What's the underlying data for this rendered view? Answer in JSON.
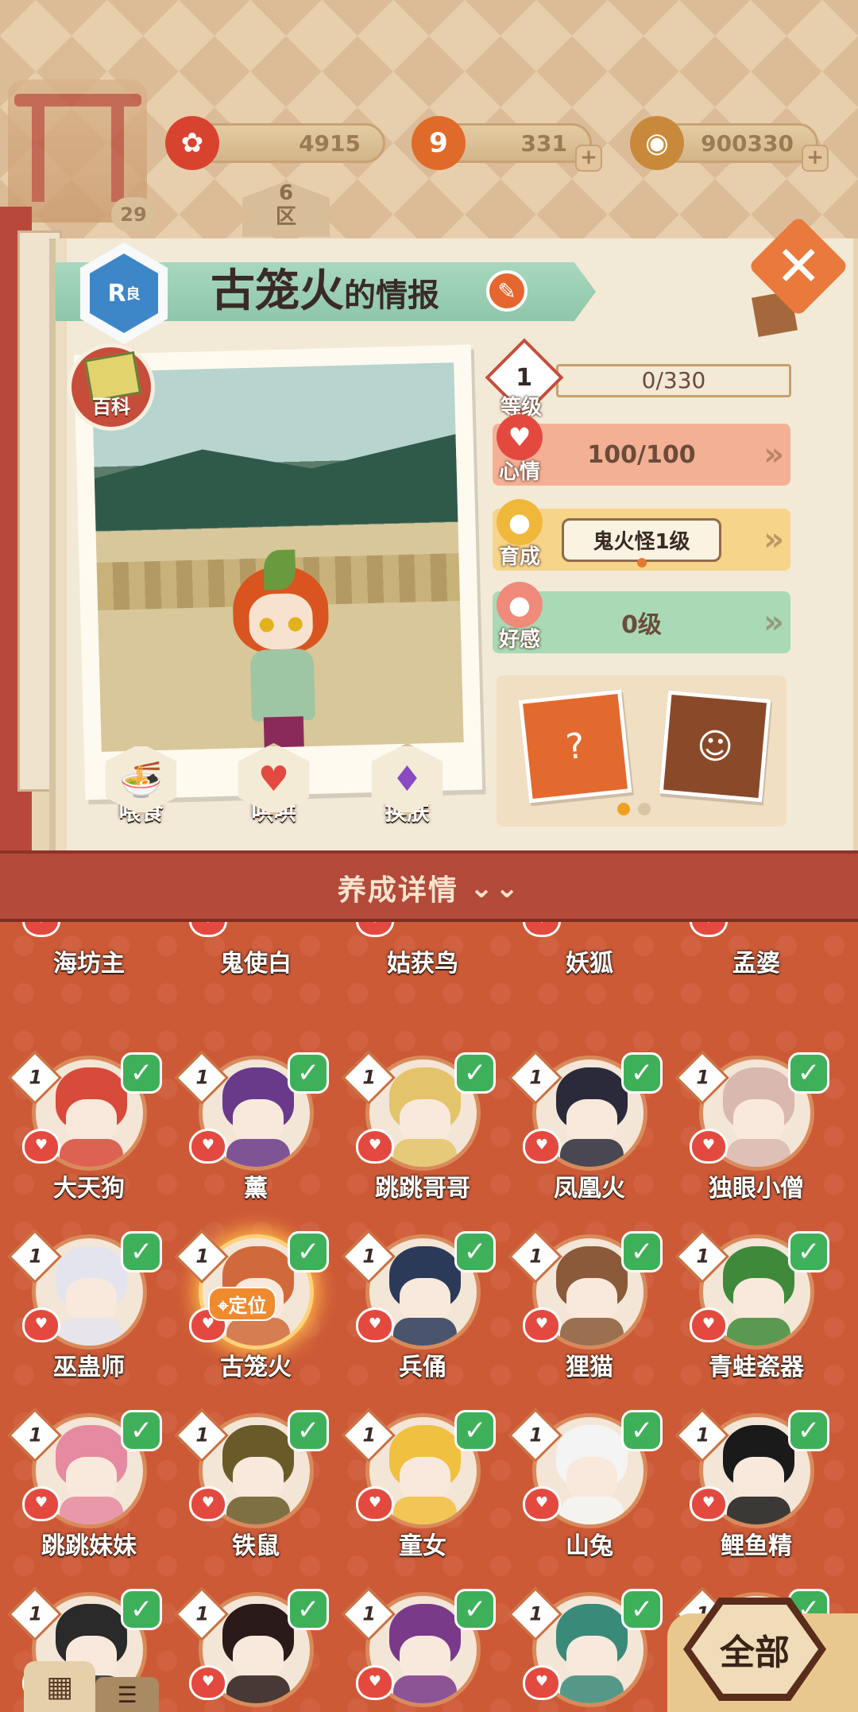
{
  "header": {
    "player_level": "29",
    "region_number": "6",
    "region_label": "区",
    "resources": [
      {
        "name": "flower",
        "value": "4915",
        "icon": "plum-blossom-icon",
        "color": "#d8432f"
      },
      {
        "name": "nine",
        "value": "331",
        "icon": "nine-token-icon",
        "color": "#e06a2a"
      },
      {
        "name": "coins",
        "value": "900330",
        "icon": "coin-icon",
        "color": "#c88a3a"
      }
    ]
  },
  "info": {
    "rarity": "R",
    "rarity_suffix": "良",
    "name": "古笼火",
    "title_suffix": "的情报",
    "encyclopedia_label": "百科",
    "actions": [
      {
        "label": "喂食",
        "icon": "noodle-bowl-icon"
      },
      {
        "label": "哄哄",
        "icon": "milk-carton-icon"
      },
      {
        "label": "换肤",
        "icon": "outfit-icon"
      }
    ],
    "level": {
      "value": "1",
      "label": "等级",
      "exp": "0/330"
    },
    "mood": {
      "label": "心情",
      "value": "100/100"
    },
    "growth": {
      "label": "育成",
      "value": "鬼火怪1级"
    },
    "affinity": {
      "label": "好感",
      "value": "0级"
    },
    "gift_page": 1,
    "gift_pages": 2
  },
  "details_bar": {
    "label": "养成详情"
  },
  "grid": {
    "rows": [
      [
        {
          "name": "海坊主",
          "level": "",
          "checked": false
        },
        {
          "name": "鬼使白",
          "level": "",
          "checked": false
        },
        {
          "name": "姑获鸟",
          "level": "",
          "checked": false
        },
        {
          "name": "妖狐",
          "level": "",
          "checked": false
        },
        {
          "name": "孟婆",
          "level": "",
          "checked": false
        }
      ],
      [
        {
          "name": "大天狗",
          "level": "1",
          "checked": true
        },
        {
          "name": "薰",
          "level": "1",
          "checked": true
        },
        {
          "name": "跳跳哥哥",
          "level": "1",
          "checked": true
        },
        {
          "name": "凤凰火",
          "level": "1",
          "checked": true
        },
        {
          "name": "独眼小僧",
          "level": "1",
          "checked": true
        }
      ],
      [
        {
          "name": "巫蛊师",
          "level": "1",
          "checked": true
        },
        {
          "name": "古笼火",
          "level": "1",
          "checked": true,
          "selected": true,
          "tag": "定位"
        },
        {
          "name": "兵俑",
          "level": "1",
          "checked": true
        },
        {
          "name": "狸猫",
          "level": "1",
          "checked": true
        },
        {
          "name": "青蛙瓷器",
          "level": "1",
          "checked": true
        }
      ],
      [
        {
          "name": "跳跳妹妹",
          "level": "1",
          "checked": true
        },
        {
          "name": "铁鼠",
          "level": "1",
          "checked": true
        },
        {
          "name": "童女",
          "level": "1",
          "checked": true
        },
        {
          "name": "山兔",
          "level": "1",
          "checked": true
        },
        {
          "name": "鲤鱼精",
          "level": "1",
          "checked": true
        }
      ],
      [
        {
          "name": "",
          "level": "1",
          "checked": true
        },
        {
          "name": "",
          "level": "1",
          "checked": true
        },
        {
          "name": "",
          "level": "1",
          "checked": true
        },
        {
          "name": "",
          "level": "1",
          "checked": true
        },
        {
          "name": "",
          "level": "1",
          "checked": true
        }
      ]
    ],
    "portrait_colors": [
      "#c0364a",
      "#f2f2f2",
      "#3b3f6a",
      "#f4f4f4",
      "#5a4a7a",
      "#d84a3a",
      "#6a3a8a",
      "#e3c46a",
      "#2a2a3a",
      "#d9b8b0",
      "#e4e4ee",
      "#d06a3a",
      "#2c3a5a",
      "#8a5a3a",
      "#3f8a3a",
      "#e58aa0",
      "#6a5a2a",
      "#f0c040",
      "#f4f4f4",
      "#1a1a1a",
      "#2a2a2a",
      "#2a1a1a",
      "#7a3a8a",
      "#3a8a7a",
      "#5a6a9a"
    ]
  },
  "controls": {
    "all_label": "全部",
    "grid_view_icon": "grid-icon",
    "list_view_icon": "list-icon"
  }
}
